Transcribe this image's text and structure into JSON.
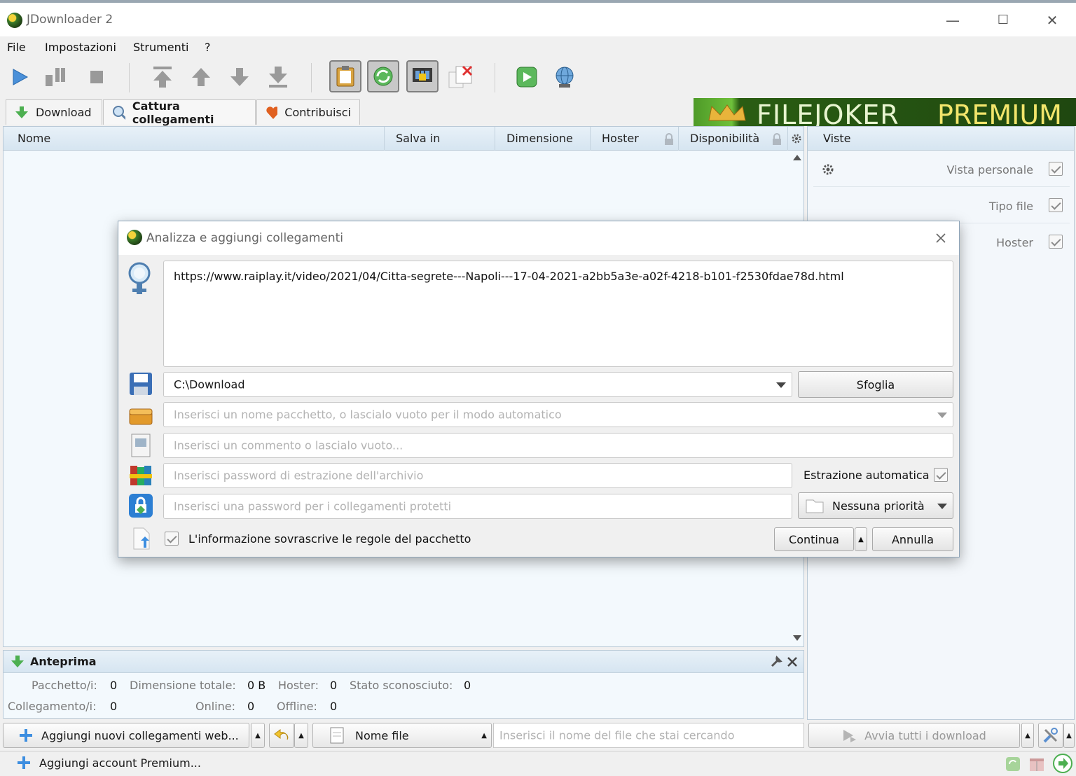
{
  "window": {
    "title": "JDownloader 2",
    "minimize": "—",
    "maximize": "☐",
    "close": "✕"
  },
  "menu": {
    "items": [
      "File",
      "Impostazioni",
      "Strumenti",
      "?"
    ]
  },
  "tabs": [
    {
      "label": "Download",
      "icon": "download-arrow-icon"
    },
    {
      "label": "Cattura collegamenti",
      "icon": "magnifier-icon"
    },
    {
      "label": "Contribuisci",
      "icon": "heart-icon"
    }
  ],
  "banner": {
    "text": "FILEJOKER",
    "premium": "PREMIUM"
  },
  "table": {
    "columns": [
      "Nome",
      "Salva in",
      "Dimensione",
      "Hoster",
      "Disponibilità"
    ]
  },
  "side_panel": {
    "header": "Viste",
    "views": [
      {
        "label": "Vista personale",
        "checked": true
      },
      {
        "label": "Tipo file",
        "checked": true
      },
      {
        "label": "Hoster",
        "checked": true
      }
    ]
  },
  "preview": {
    "title": "Anteprima",
    "packages_label": "Pacchetto/i:",
    "packages_value": "0",
    "total_size_label": "Dimensione totale:",
    "total_size_value": "0 B",
    "hoster_label": "Hoster:",
    "hoster_value": "0",
    "unknown_label": "Stato sconosciuto:",
    "unknown_value": "0",
    "links_label": "Collegamento/i:",
    "links_value": "0",
    "online_label": "Online:",
    "online_value": "0",
    "offline_label": "Offline:",
    "offline_value": "0"
  },
  "bottom": {
    "add_links": "Aggiungi nuovi collegamenti web...",
    "sort_field": "Nome file",
    "search_placeholder": "Inserisci il nome del file che stai cercando",
    "start_all": "Avvia tutti i download",
    "add_account": "Aggiungi account Premium..."
  },
  "dialog": {
    "title": "Analizza e aggiungi collegamenti",
    "links_text": "https://www.raiplay.it/video/2021/04/Citta-segrete---Napoli---17-04-2021-a2bb5a3e-a02f-4218-b101-f2530fdae78d.html",
    "save_to": "C:\\Download",
    "browse": "Sfoglia",
    "package_placeholder": "Inserisci un nome pacchetto, o lascialo vuoto per il modo automatico",
    "comment_placeholder": "Inserisci un commento o lascialo vuoto...",
    "extract_password_placeholder": "Inserisci password di estrazione dell'archivio",
    "auto_extract": "Estrazione automatica",
    "link_password_placeholder": "Inserisci una password per i collegamenti protetti",
    "priority": "Nessuna priorità",
    "overwrite_rules": "L'informazione sovrascrive le regole del pacchetto",
    "continue": "Continua",
    "cancel": "Annulla"
  },
  "colors": {
    "accent_green": "#4e9a28",
    "premium_yellow": "#f2e56b",
    "grid_blue": "#d6e5f1"
  }
}
